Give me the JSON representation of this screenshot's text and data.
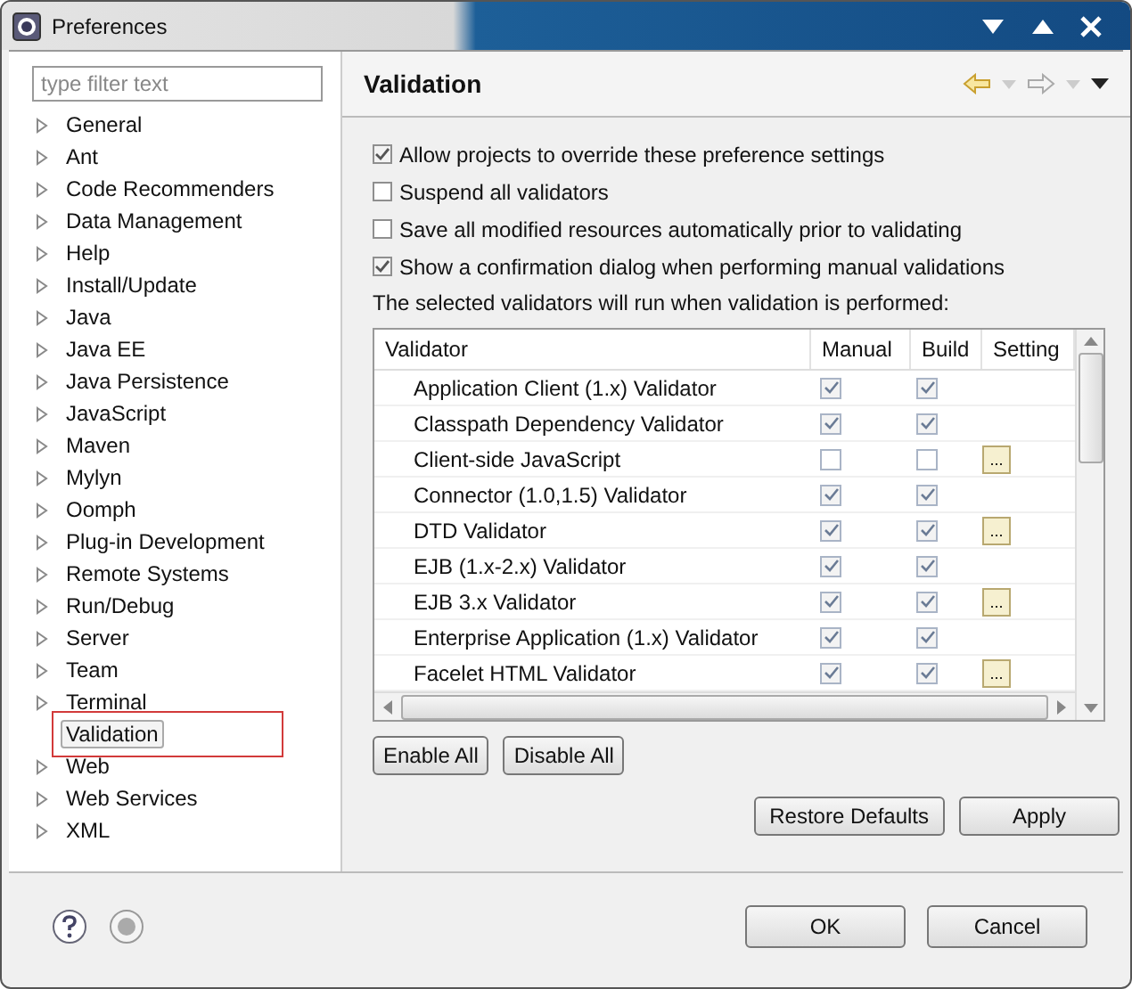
{
  "window": {
    "title": "Preferences"
  },
  "filter": {
    "placeholder": "type filter text"
  },
  "tree": [
    {
      "label": "General",
      "expandable": true,
      "selected": false
    },
    {
      "label": "Ant",
      "expandable": true,
      "selected": false
    },
    {
      "label": "Code Recommenders",
      "expandable": true,
      "selected": false
    },
    {
      "label": "Data Management",
      "expandable": true,
      "selected": false
    },
    {
      "label": "Help",
      "expandable": true,
      "selected": false
    },
    {
      "label": "Install/Update",
      "expandable": true,
      "selected": false
    },
    {
      "label": "Java",
      "expandable": true,
      "selected": false
    },
    {
      "label": "Java EE",
      "expandable": true,
      "selected": false
    },
    {
      "label": "Java Persistence",
      "expandable": true,
      "selected": false
    },
    {
      "label": "JavaScript",
      "expandable": true,
      "selected": false
    },
    {
      "label": "Maven",
      "expandable": true,
      "selected": false
    },
    {
      "label": "Mylyn",
      "expandable": true,
      "selected": false
    },
    {
      "label": "Oomph",
      "expandable": true,
      "selected": false
    },
    {
      "label": "Plug-in Development",
      "expandable": true,
      "selected": false
    },
    {
      "label": "Remote Systems",
      "expandable": true,
      "selected": false
    },
    {
      "label": "Run/Debug",
      "expandable": true,
      "selected": false
    },
    {
      "label": "Server",
      "expandable": true,
      "selected": false
    },
    {
      "label": "Team",
      "expandable": true,
      "selected": false
    },
    {
      "label": "Terminal",
      "expandable": true,
      "selected": false
    },
    {
      "label": "Validation",
      "expandable": false,
      "selected": true
    },
    {
      "label": "Web",
      "expandable": true,
      "selected": false
    },
    {
      "label": "Web Services",
      "expandable": true,
      "selected": false
    },
    {
      "label": "XML",
      "expandable": true,
      "selected": false
    }
  ],
  "page": {
    "title": "Validation"
  },
  "options": [
    {
      "label": "Allow projects to override these preference settings",
      "checked": true
    },
    {
      "label": "Suspend all validators",
      "checked": false
    },
    {
      "label": "Save all modified resources automatically prior to validating",
      "checked": false
    },
    {
      "label": "Show a confirmation dialog when performing manual validations",
      "checked": true
    }
  ],
  "note": "The selected validators will run when validation is performed:",
  "table": {
    "columns": [
      "Validator",
      "Manual",
      "Build",
      "Setting"
    ],
    "rows": [
      {
        "name": "Application Client (1.x) Validator",
        "manual": true,
        "build": true,
        "settings": false
      },
      {
        "name": "Classpath Dependency Validator",
        "manual": true,
        "build": true,
        "settings": false
      },
      {
        "name": "Client-side JavaScript",
        "manual": false,
        "build": false,
        "settings": true
      },
      {
        "name": "Connector (1.0,1.5) Validator",
        "manual": true,
        "build": true,
        "settings": false
      },
      {
        "name": "DTD Validator",
        "manual": true,
        "build": true,
        "settings": true
      },
      {
        "name": "EJB (1.x-2.x) Validator",
        "manual": true,
        "build": true,
        "settings": false
      },
      {
        "name": "EJB 3.x Validator",
        "manual": true,
        "build": true,
        "settings": true
      },
      {
        "name": "Enterprise Application (1.x) Validator",
        "manual": true,
        "build": true,
        "settings": false
      },
      {
        "name": "Facelet HTML Validator",
        "manual": true,
        "build": true,
        "settings": true
      }
    ],
    "settings_label": "..."
  },
  "table_buttons": [
    "Enable All",
    "Disable All"
  ],
  "page_buttons": [
    "Restore Defaults",
    "Apply"
  ],
  "dialog_buttons": [
    "OK",
    "Cancel"
  ]
}
